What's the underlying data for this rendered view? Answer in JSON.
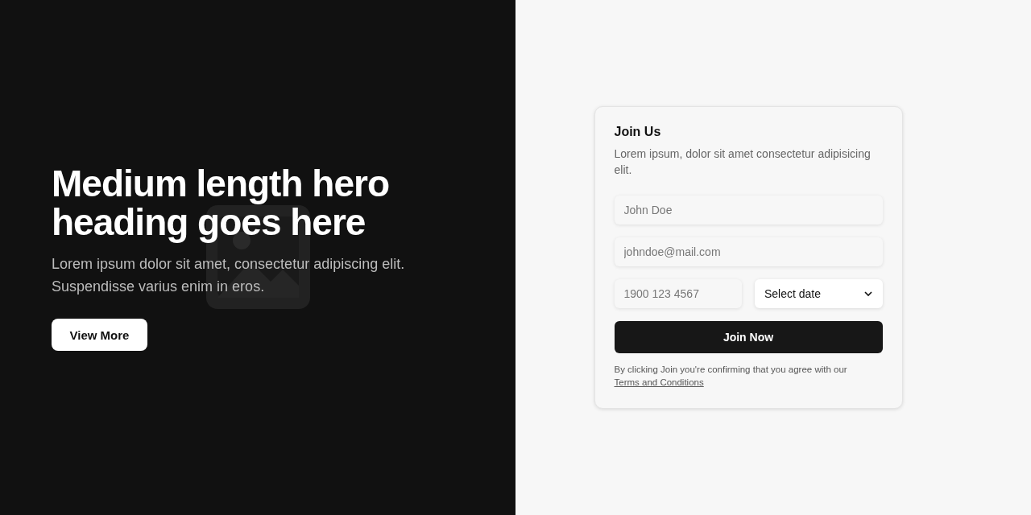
{
  "hero": {
    "heading": "Medium length hero heading goes here",
    "text": "Lorem ipsum dolor sit amet, consectetur adipiscing elit. Suspendisse varius enim in eros.",
    "button": "View More"
  },
  "form": {
    "title": "Join Us",
    "subtitle": "Lorem ipsum, dolor sit amet consectetur adipisicing elit.",
    "fields": [
      {
        "kind": "input",
        "placeholder": "John Doe"
      },
      {
        "kind": "input",
        "placeholder": "johndoe@mail.com"
      }
    ],
    "row": [
      {
        "kind": "input",
        "placeholder": "1900 123 4567"
      },
      {
        "kind": "select",
        "value": "Select date"
      }
    ],
    "submit": "Join Now",
    "legal": {
      "text": "By clicking Join you're confirming that you agree with our",
      "link": "Terms and Conditions"
    }
  }
}
